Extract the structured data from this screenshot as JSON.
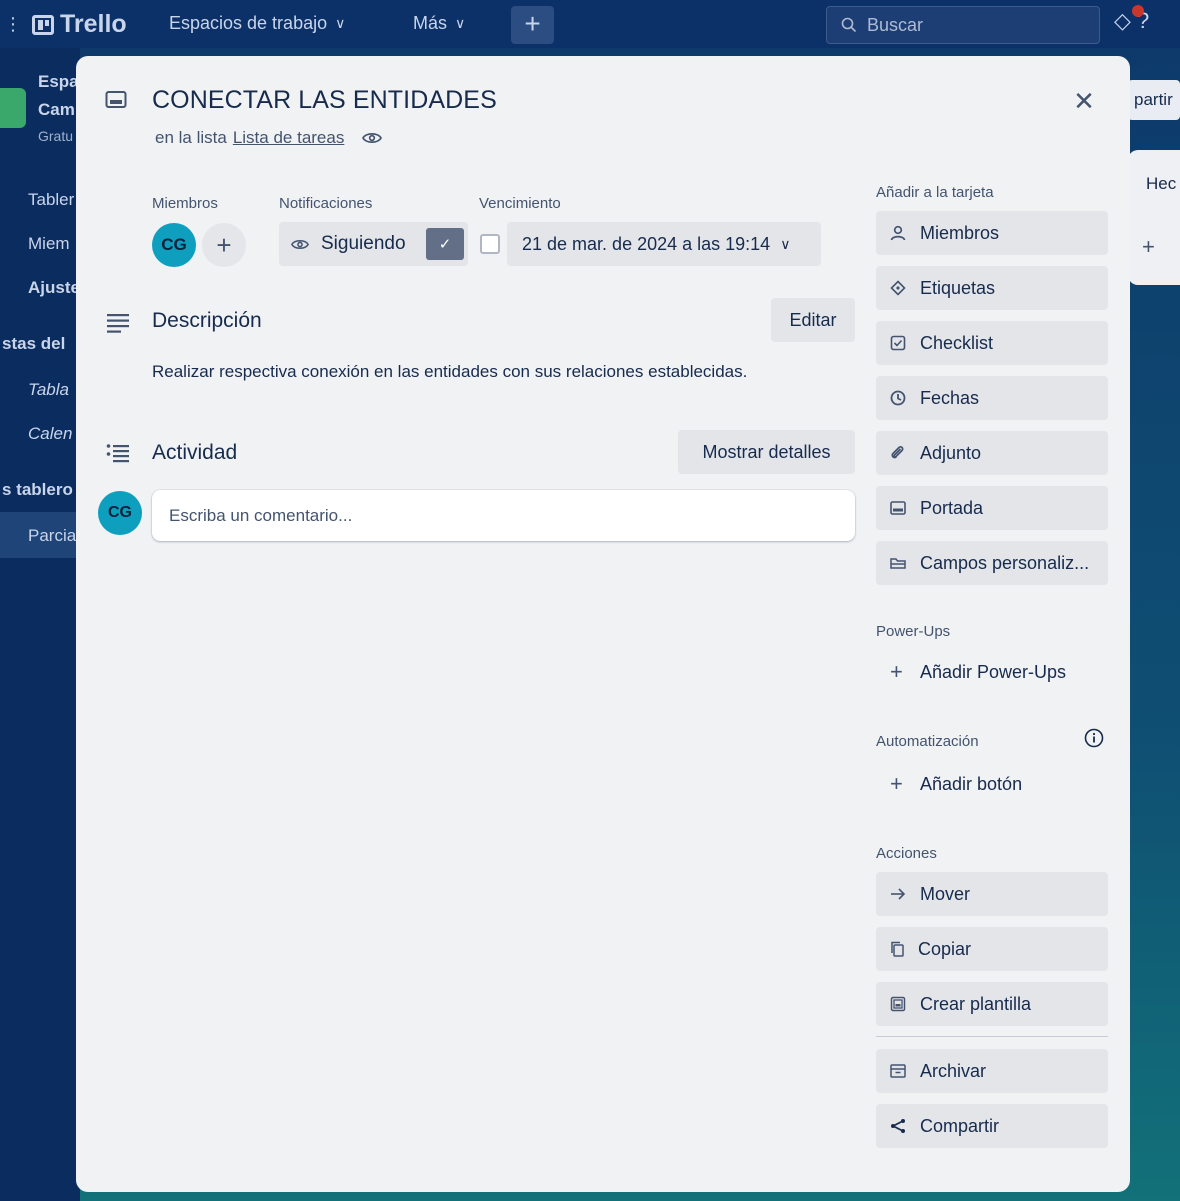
{
  "app": {
    "logo": "Trello",
    "nav": {
      "workspaces": "Espacios de trabajo",
      "more": "Más",
      "create": "+"
    },
    "search_placeholder": "Buscar"
  },
  "sidebar_partial": {
    "workspace_name_1": "Espa",
    "workspace_name_2": "Cam",
    "workspace_plan": "Gratu",
    "item_boards": "Tabler",
    "item_members": "Miem",
    "item_settings": "Ajuste",
    "section_views": "stas del",
    "view_table": "Tabla",
    "view_calendar": "Calen",
    "section_boards": "s tablero",
    "board_item": "Parcia"
  },
  "board_partial": {
    "share_button": "partir",
    "list_title": "Hec",
    "add_card": "+"
  },
  "card": {
    "title": "CONECTAR LAS ENTIDADES",
    "in_list_prefix": "en la lista",
    "list_name": "Lista de tareas",
    "members_label": "Miembros",
    "member_initials": "CG",
    "notifications_label": "Notificaciones",
    "follow_label": "Siguiendo",
    "due_label": "Vencimiento",
    "due_value": "21 de mar. de 2024 a las 19:14",
    "description": {
      "title": "Descripción",
      "edit_button": "Editar",
      "text": "Realizar respectiva conexión en las entidades con sus relaciones establecidas."
    },
    "activity": {
      "title": "Actividad",
      "details_button": "Mostrar detalles",
      "comment_placeholder": "Escriba un comentario...",
      "avatar_initials": "CG"
    }
  },
  "sidebar_actions": {
    "add_to_card": {
      "heading": "Añadir a la tarjeta",
      "items": [
        "Miembros",
        "Etiquetas",
        "Checklist",
        "Fechas",
        "Adjunto",
        "Portada",
        "Campos personaliz..."
      ]
    },
    "powerups": {
      "heading": "Power-Ups",
      "add": "Añadir Power-Ups"
    },
    "automation": {
      "heading": "Automatización",
      "add": "Añadir botón"
    },
    "actions": {
      "heading": "Acciones",
      "items": [
        "Mover",
        "Copiar",
        "Crear plantilla",
        "Archivar",
        "Compartir"
      ]
    }
  },
  "colors": {
    "modal_bg": "#f1f2f4",
    "button_bg": "#e3e5e9",
    "avatar": "#0e9fbf",
    "check_bg": "#626f86",
    "text": "#172b4d"
  }
}
